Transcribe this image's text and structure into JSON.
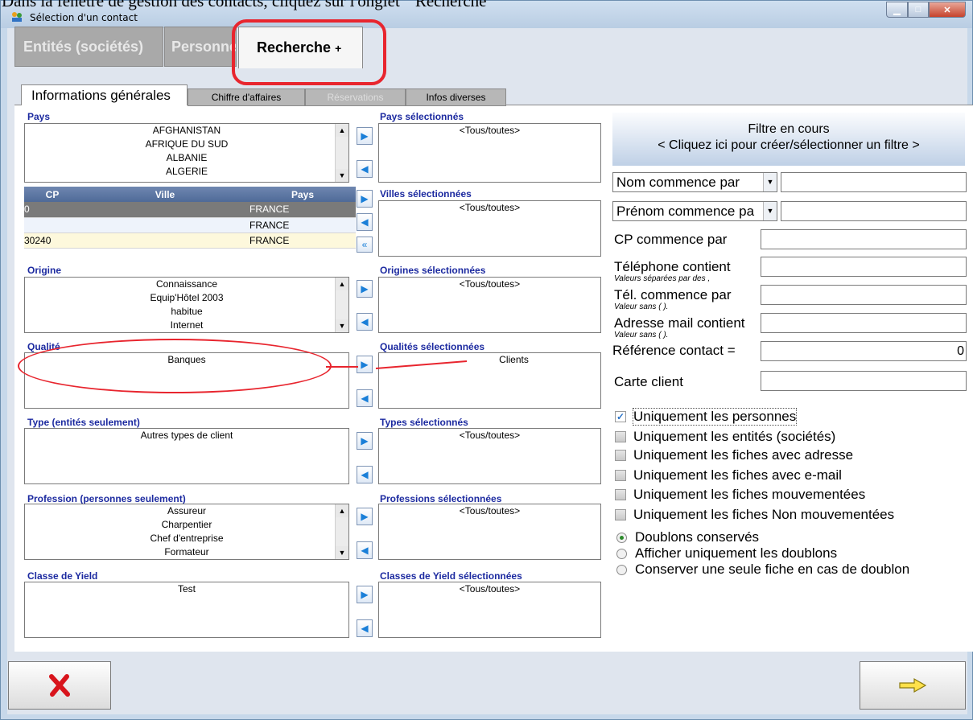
{
  "caption": "Dans la fenêtre de gestion des contacts, cliquez sur l'onglet \" Recherche \"",
  "window": {
    "title": "Sélection d'un contact"
  },
  "top_tabs": [
    {
      "label": "Entités (sociétés)"
    },
    {
      "label": "Personnes"
    },
    {
      "label": "Recherche",
      "suffix": "+"
    }
  ],
  "sub_tabs": [
    {
      "label": "Informations générales"
    },
    {
      "label": "Chiffre d'affaires"
    },
    {
      "label": "Réservations"
    },
    {
      "label": "Infos diverses"
    }
  ],
  "pays": {
    "label": "Pays",
    "items": [
      "AFGHANISTAN",
      "AFRIQUE DU SUD",
      "ALBANIE",
      "ALGERIE"
    ],
    "selected_label": "Pays sélectionnés",
    "selected": [
      "<Tous/toutes>"
    ]
  },
  "villes": {
    "columns": [
      "CP",
      "Ville",
      "Pays"
    ],
    "rows": [
      [
        "0",
        "",
        "FRANCE"
      ],
      [
        "",
        "",
        "FRANCE"
      ],
      [
        "30240",
        "",
        "FRANCE"
      ]
    ],
    "selected_label": "Villes sélectionnées",
    "selected": [
      "<Tous/toutes>"
    ]
  },
  "origine": {
    "label": "Origine",
    "items": [
      "Connaissance",
      "Equip'Hôtel 2003",
      "habitue",
      "Internet"
    ],
    "selected_label": "Origines sélectionnées",
    "selected": [
      "<Tous/toutes>"
    ]
  },
  "qualite": {
    "label": "Qualité",
    "items": [
      "Banques"
    ],
    "selected_label": "Qualités sélectionnées",
    "selected": [
      "Clients"
    ]
  },
  "type": {
    "label": "Type (entités seulement)",
    "items": [
      "Autres types de client"
    ],
    "selected_label": "Types sélectionnés",
    "selected": [
      "<Tous/toutes>"
    ]
  },
  "profession": {
    "label": "Profession (personnes seulement)",
    "items": [
      "Assureur",
      "Charpentier",
      "Chef d'entreprise",
      "Formateur"
    ],
    "selected_label": "Professions sélectionnées",
    "selected": [
      "<Tous/toutes>"
    ]
  },
  "yield": {
    "label": "Classe de Yield",
    "items": [
      "Test"
    ],
    "selected_label": "Classes de Yield sélectionnées",
    "selected": [
      "<Tous/toutes>"
    ]
  },
  "filter": {
    "line1": "Filtre en cours",
    "line2": "< Cliquez ici pour créer/sélectionner un filtre >"
  },
  "fields": {
    "nom": "Nom commence par",
    "prenom": "Prénom commence pa",
    "cp": "CP commence par",
    "tel": "Téléphone contient",
    "tel_hint": "Valeurs séparées par des ,",
    "telc": "Tél. commence par",
    "telc_hint": "Valeur sans ( ).",
    "mail": "Adresse mail contient",
    "mail_hint": "Valeur sans ( ).",
    "ref": "Référence contact =",
    "ref_value": "0",
    "carte": "Carte client"
  },
  "checks": [
    {
      "label": "Uniquement les personnes",
      "checked": true
    },
    {
      "label": "Uniquement les entités (sociétés)",
      "checked": false
    },
    {
      "label": "Uniquement les fiches avec adresse",
      "checked": false
    },
    {
      "label": "Uniquement les fiches avec e-mail",
      "checked": false
    },
    {
      "label": "Uniquement les fiches mouvementées",
      "checked": false
    },
    {
      "label": "Uniquement les fiches Non mouvementées",
      "checked": false
    }
  ],
  "radios": [
    {
      "label": "Doublons conservés",
      "checked": true
    },
    {
      "label": "Afficher uniquement les doublons",
      "checked": false
    },
    {
      "label": "Conserver une seule fiche en cas de doublon",
      "checked": false
    }
  ],
  "colors": {
    "label_blue": "#1c2aa0",
    "highlight_red": "#e8252e",
    "grid_header": "#5b74a2"
  }
}
